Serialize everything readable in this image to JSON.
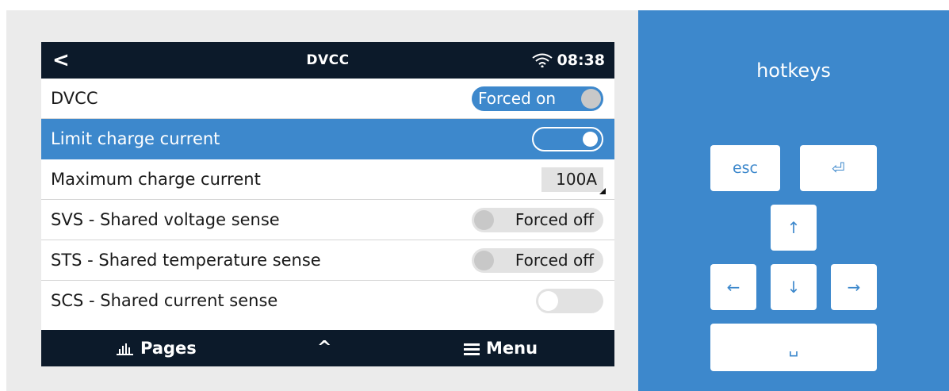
{
  "device": {
    "back_symbol": "<",
    "title": "DVCC",
    "time": "08:38",
    "rows": [
      {
        "label": "DVCC",
        "value": "Forced on"
      },
      {
        "label": "Limit charge current",
        "value": ""
      },
      {
        "label": "Maximum charge current",
        "value": "100A"
      },
      {
        "label": "SVS - Shared voltage sense",
        "value": "Forced off"
      },
      {
        "label": "STS - Shared temperature sense",
        "value": "Forced off"
      },
      {
        "label": "SCS - Shared current sense",
        "value": ""
      }
    ],
    "footer": {
      "pages_label": "Pages",
      "up_symbol": "^",
      "menu_label": "Menu"
    }
  },
  "hotkeys": {
    "title": "hotkeys",
    "keys": {
      "esc": "esc",
      "enter": "⏎",
      "up": "↑",
      "left": "←",
      "down": "↓",
      "right": "→",
      "space": "␣"
    }
  },
  "colors": {
    "accent": "#3d88cc",
    "bar": "#0c1a2a"
  }
}
